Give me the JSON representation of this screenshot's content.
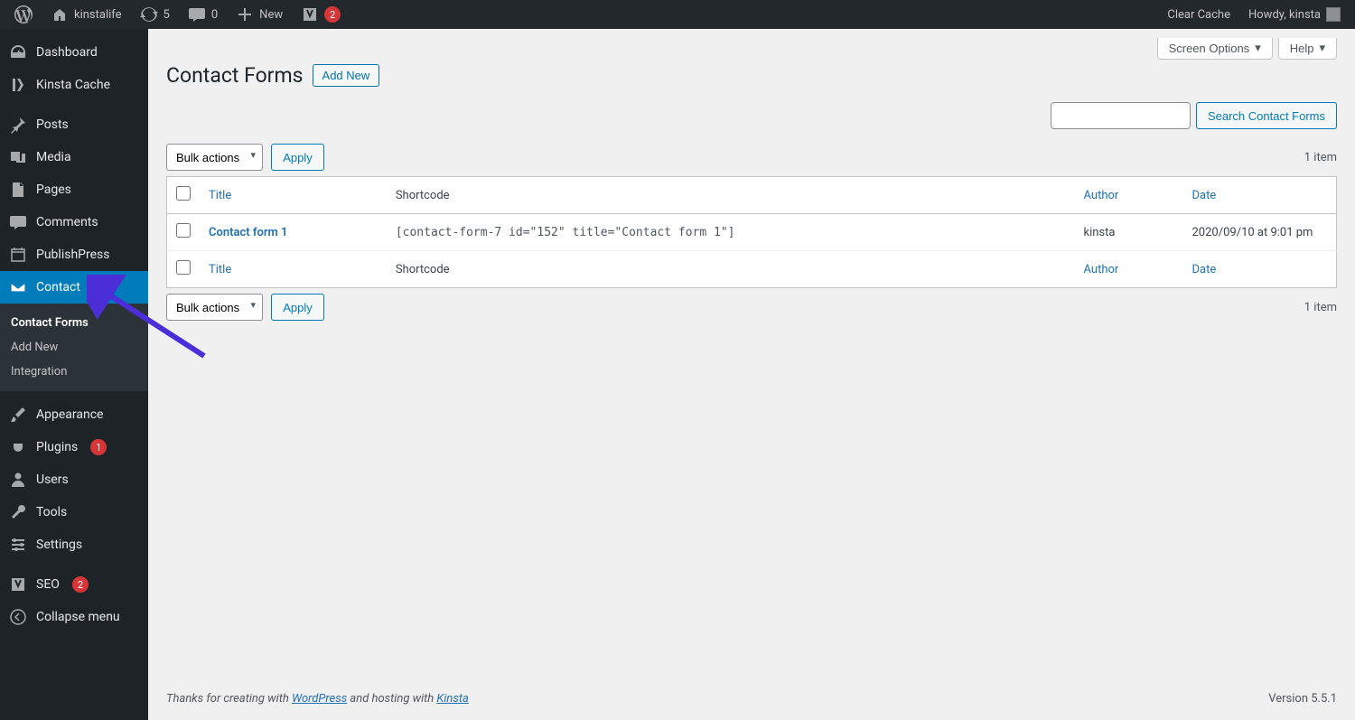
{
  "adminbar": {
    "site_name": "kinstalife",
    "updates_count": "5",
    "comments_count": "0",
    "new_label": "New",
    "yoast_count": "2",
    "clear_cache": "Clear Cache",
    "howdy": "Howdy, kinsta"
  },
  "sidebar": {
    "dashboard": "Dashboard",
    "kinsta_cache": "Kinsta Cache",
    "posts": "Posts",
    "media": "Media",
    "pages": "Pages",
    "comments": "Comments",
    "publishpress": "PublishPress",
    "contact": "Contact",
    "appearance": "Appearance",
    "plugins": "Plugins",
    "plugins_badge": "1",
    "users": "Users",
    "tools": "Tools",
    "settings": "Settings",
    "seo": "SEO",
    "seo_badge": "2",
    "collapse": "Collapse menu",
    "submenu": {
      "contact_forms": "Contact Forms",
      "add_new": "Add New",
      "integration": "Integration"
    }
  },
  "top_actions": {
    "screen_options": "Screen Options",
    "help": "Help"
  },
  "heading": {
    "title": "Contact Forms",
    "add_new": "Add New"
  },
  "search": {
    "button": "Search Contact Forms"
  },
  "bulk": {
    "label": "Bulk actions",
    "apply": "Apply"
  },
  "count": "1 item",
  "table": {
    "headers": {
      "title": "Title",
      "shortcode": "Shortcode",
      "author": "Author",
      "date": "Date"
    },
    "rows": [
      {
        "title": "Contact form 1",
        "shortcode": "[contact-form-7 id=\"152\" title=\"Contact form 1\"]",
        "author": "kinsta",
        "date": "2020/09/10 at 9:01 pm"
      }
    ]
  },
  "footer": {
    "thanks_pre": "Thanks for creating with ",
    "wordpress": "WordPress",
    "and_host": " and hosting with ",
    "kinsta": "Kinsta",
    "version": "Version 5.5.1"
  }
}
